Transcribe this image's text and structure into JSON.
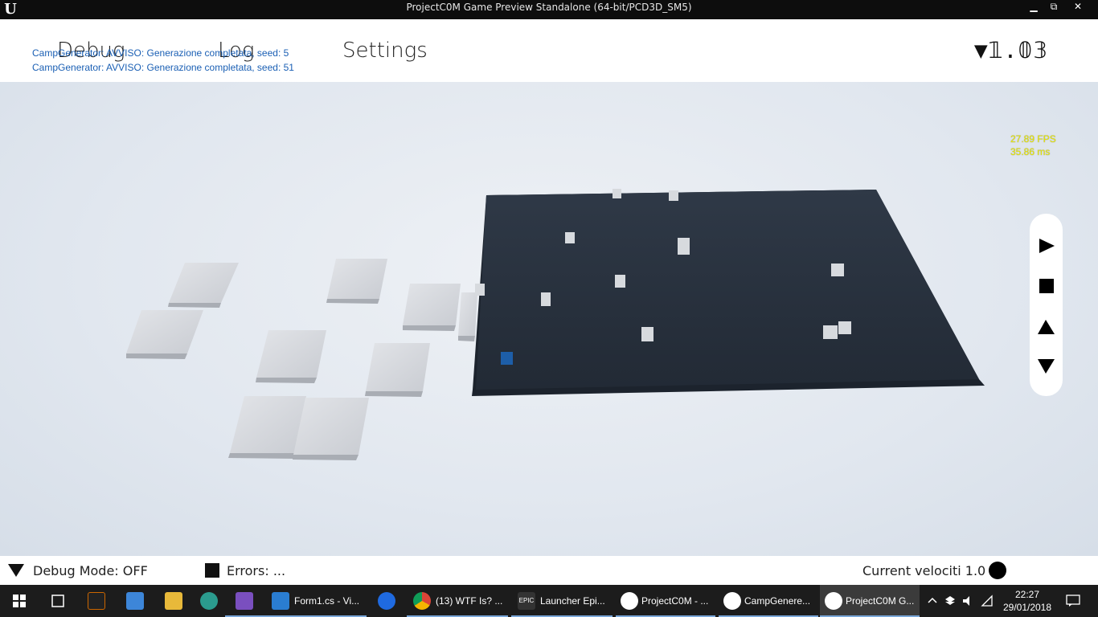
{
  "window": {
    "title": "ProjectC0M Game Preview Standalone (64-bit/PCD3D_SM5)",
    "logo_icon": "unreal-engine-logo",
    "min_label": "▁",
    "restore_label": "⧉",
    "close_label": "✕"
  },
  "app_menu": {
    "debug": "Debug",
    "log": "Log",
    "settings": "Settings",
    "brand": "▼𝟙.𝟘𝟛"
  },
  "log_messages": [
    "CampGenerator: AVVISO: Generazione completata, seed: 5",
    "CampGenerator: AVVISO: Generazione completata, seed: 51"
  ],
  "stats": {
    "fps": "27.89 FPS",
    "ms": "35.86 ms"
  },
  "controls": {
    "play_icon": "play-icon",
    "stop_icon": "stop-icon",
    "up_icon": "arrow-up-icon",
    "down_icon": "arrow-down-icon"
  },
  "status": {
    "debug_mode": "Debug Mode: OFF",
    "errors": "Errors: ...",
    "velocity": "Current velociti  1.0"
  },
  "taskbar": {
    "items": [
      {
        "label": "Form1.cs - Vi..."
      },
      {
        "label": "(13) WTF Is? ..."
      },
      {
        "label": "Launcher Epi..."
      },
      {
        "label": "ProjectC0M - ..."
      },
      {
        "label": "CampGenere..."
      },
      {
        "label": "ProjectC0M G..."
      }
    ],
    "time": "22:27",
    "date": "29/01/2018"
  },
  "colors": {
    "board": "#2a3340",
    "tile": "#d6d9de",
    "accent": "#1a5fb4",
    "fps": "#e8e800"
  }
}
